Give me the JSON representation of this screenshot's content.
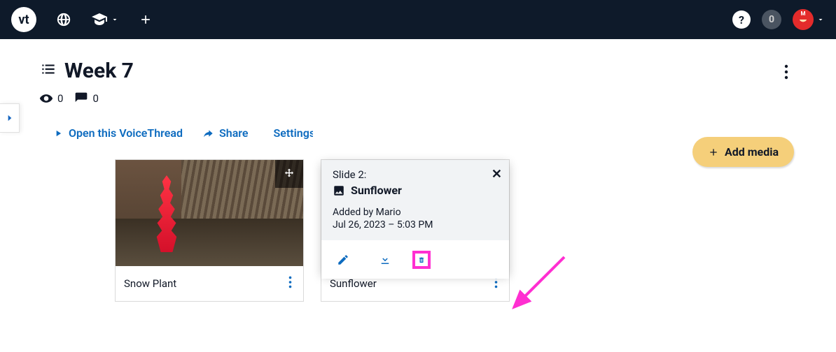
{
  "topbar": {
    "logo_text": "vt",
    "help_label": "?",
    "notif_count": "0"
  },
  "sidebar_toggle": {},
  "page": {
    "title": "Week 7",
    "views": "0",
    "comments": "0",
    "more_menu": "more"
  },
  "actions": {
    "open": "Open this VoiceThread",
    "share": "Share",
    "settings": "Settings"
  },
  "add_media": {
    "label": "Add media"
  },
  "cards": [
    {
      "title": "Snow Plant"
    },
    {
      "title": "Sunflower"
    }
  ],
  "popover": {
    "slide_label": "Slide 2:",
    "title": "Sunflower",
    "added_by": "Added by Mario",
    "timestamp": "Jul 26, 2023 – 5:03 PM"
  }
}
